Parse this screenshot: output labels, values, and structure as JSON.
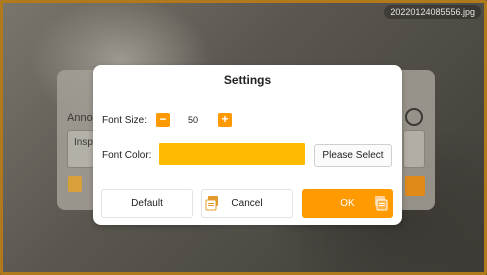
{
  "image": {
    "filename": "20220124085556.jpg"
  },
  "background_panel": {
    "label": "Anno",
    "field_text": "Insp",
    "icons": [
      "settings-gear-icon",
      "document-icon",
      "document-icon"
    ]
  },
  "dialog": {
    "title": "Settings",
    "font_size_label": "Font Size:",
    "font_size_value": "50",
    "decrease_label": "−",
    "increase_label": "+",
    "font_color_label": "Font Color:",
    "font_color_value": "#ffbb00",
    "select_button": "Please Select",
    "default_button": "Default",
    "cancel_button": "Cancel",
    "ok_button": "OK"
  },
  "colors": {
    "accent": "#ff9a00",
    "swatch": "#ffbb00",
    "dialog_bg": "#ffffff"
  }
}
